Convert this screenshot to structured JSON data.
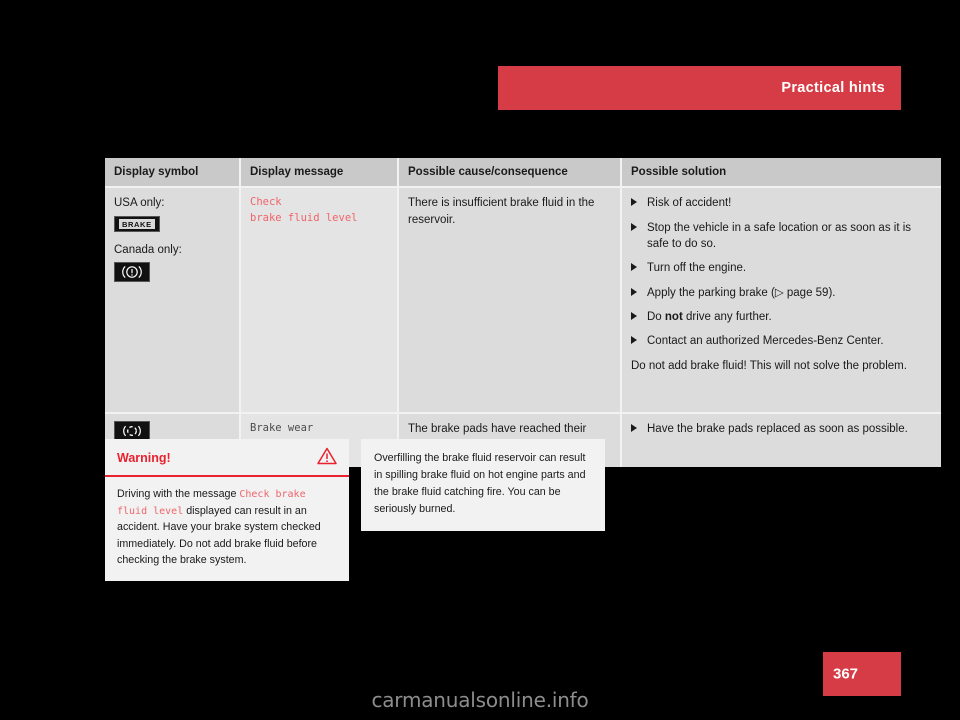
{
  "header": {
    "title": "Practical hints",
    "band_color": "#d63c45"
  },
  "table": {
    "columns": [
      "Display symbol",
      "Display message",
      "Possible cause/consequence",
      "Possible solution"
    ],
    "rows": [
      {
        "symbol": {
          "usa_label": "USA only:",
          "usa_icon": "brake-warning-icon",
          "usa_icon_text": "BRAKE",
          "canada_label": "Canada only:",
          "canada_icon": "brake-circle-exclamation-icon"
        },
        "message": "Check\nbrake fluid level",
        "message_color": "#f0646a",
        "cause": "There is insufficient brake fluid in the reservoir.",
        "solutions": [
          "Risk of accident!",
          "Stop the vehicle in a safe location or as soon as it is safe to do so.",
          "Turn off the engine.",
          "Apply the parking brake (▷ page 59).",
          "Do not drive any further.",
          "Contact an authorized Mercedes-Benz Center."
        ],
        "solution_bullet_5_pre": "Do ",
        "solution_bullet_5_bold": "not",
        "solution_bullet_5_post": " drive any further.",
        "solution_note": "Do not add brake fluid! This will not solve the problem."
      },
      {
        "symbol": {
          "icon": "brake-wear-icon"
        },
        "message": "Brake wear",
        "message_color": "#4a4a4a",
        "cause": "The brake pads have reached their wear limit.",
        "solutions": [
          "Have the brake pads replaced as soon as possible."
        ]
      }
    ]
  },
  "warning_box": {
    "title": "Warning!",
    "icon": "warning-triangle-icon",
    "icon_color": "#e8222e",
    "text_part_1": "Driving with the message ",
    "text_mono": "Check brake fluid level",
    "text_part_2": " displayed can result in an accident. Have your brake system checked immediately. Do not add brake fluid before checking the brake system."
  },
  "note_box": {
    "text": "Overfilling the brake fluid reservoir can result in spilling brake fluid on hot engine parts and the brake fluid catching fire. You can be seriously burned."
  },
  "page_number": {
    "value": "367",
    "box_color": "#d63c45"
  },
  "watermark": {
    "text": "carmanualsonline.info"
  }
}
